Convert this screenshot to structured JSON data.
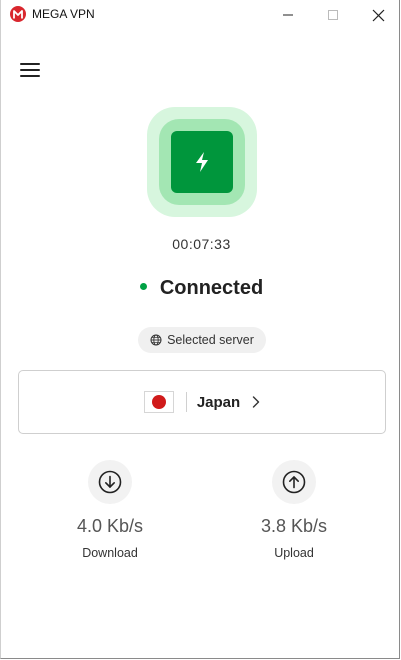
{
  "window": {
    "title": "MEGA VPN"
  },
  "connection": {
    "timer": "00:07:33",
    "status": "Connected",
    "status_color": "#00a144"
  },
  "server": {
    "chip_label": "Selected server",
    "location": "Japan",
    "flag_icon": "japan-flag-icon"
  },
  "stats": {
    "download": {
      "value": "4.0 Kb/s",
      "label": "Download"
    },
    "upload": {
      "value": "3.8 Kb/s",
      "label": "Upload"
    }
  },
  "colors": {
    "brand_red": "#d9272e",
    "power_green": "#00963c",
    "halo_outer": "#d7f6de",
    "halo_inner": "#a3e6b3"
  }
}
